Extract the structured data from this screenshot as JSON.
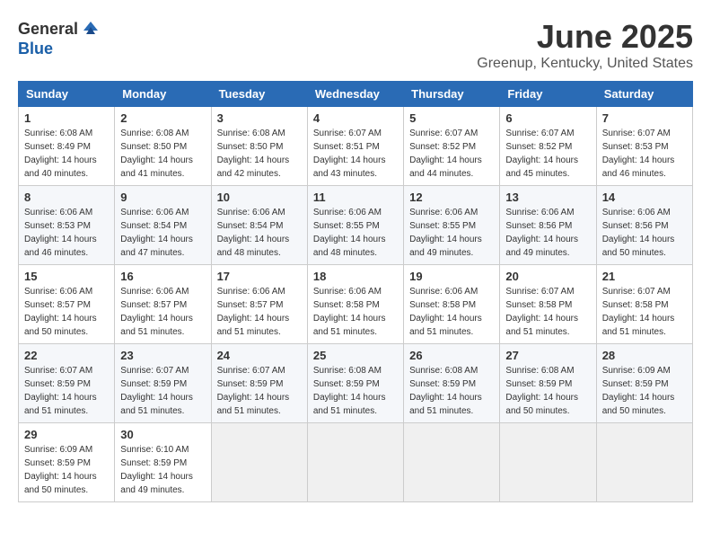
{
  "header": {
    "logo_general": "General",
    "logo_blue": "Blue",
    "month": "June 2025",
    "location": "Greenup, Kentucky, United States"
  },
  "weekdays": [
    "Sunday",
    "Monday",
    "Tuesday",
    "Wednesday",
    "Thursday",
    "Friday",
    "Saturday"
  ],
  "weeks": [
    [
      {
        "day": "1",
        "sunrise": "6:08 AM",
        "sunset": "8:49 PM",
        "daylight": "14 hours and 40 minutes."
      },
      {
        "day": "2",
        "sunrise": "6:08 AM",
        "sunset": "8:50 PM",
        "daylight": "14 hours and 41 minutes."
      },
      {
        "day": "3",
        "sunrise": "6:08 AM",
        "sunset": "8:50 PM",
        "daylight": "14 hours and 42 minutes."
      },
      {
        "day": "4",
        "sunrise": "6:07 AM",
        "sunset": "8:51 PM",
        "daylight": "14 hours and 43 minutes."
      },
      {
        "day": "5",
        "sunrise": "6:07 AM",
        "sunset": "8:52 PM",
        "daylight": "14 hours and 44 minutes."
      },
      {
        "day": "6",
        "sunrise": "6:07 AM",
        "sunset": "8:52 PM",
        "daylight": "14 hours and 45 minutes."
      },
      {
        "day": "7",
        "sunrise": "6:07 AM",
        "sunset": "8:53 PM",
        "daylight": "14 hours and 46 minutes."
      }
    ],
    [
      {
        "day": "8",
        "sunrise": "6:06 AM",
        "sunset": "8:53 PM",
        "daylight": "14 hours and 46 minutes."
      },
      {
        "day": "9",
        "sunrise": "6:06 AM",
        "sunset": "8:54 PM",
        "daylight": "14 hours and 47 minutes."
      },
      {
        "day": "10",
        "sunrise": "6:06 AM",
        "sunset": "8:54 PM",
        "daylight": "14 hours and 48 minutes."
      },
      {
        "day": "11",
        "sunrise": "6:06 AM",
        "sunset": "8:55 PM",
        "daylight": "14 hours and 48 minutes."
      },
      {
        "day": "12",
        "sunrise": "6:06 AM",
        "sunset": "8:55 PM",
        "daylight": "14 hours and 49 minutes."
      },
      {
        "day": "13",
        "sunrise": "6:06 AM",
        "sunset": "8:56 PM",
        "daylight": "14 hours and 49 minutes."
      },
      {
        "day": "14",
        "sunrise": "6:06 AM",
        "sunset": "8:56 PM",
        "daylight": "14 hours and 50 minutes."
      }
    ],
    [
      {
        "day": "15",
        "sunrise": "6:06 AM",
        "sunset": "8:57 PM",
        "daylight": "14 hours and 50 minutes."
      },
      {
        "day": "16",
        "sunrise": "6:06 AM",
        "sunset": "8:57 PM",
        "daylight": "14 hours and 51 minutes."
      },
      {
        "day": "17",
        "sunrise": "6:06 AM",
        "sunset": "8:57 PM",
        "daylight": "14 hours and 51 minutes."
      },
      {
        "day": "18",
        "sunrise": "6:06 AM",
        "sunset": "8:58 PM",
        "daylight": "14 hours and 51 minutes."
      },
      {
        "day": "19",
        "sunrise": "6:06 AM",
        "sunset": "8:58 PM",
        "daylight": "14 hours and 51 minutes."
      },
      {
        "day": "20",
        "sunrise": "6:07 AM",
        "sunset": "8:58 PM",
        "daylight": "14 hours and 51 minutes."
      },
      {
        "day": "21",
        "sunrise": "6:07 AM",
        "sunset": "8:58 PM",
        "daylight": "14 hours and 51 minutes."
      }
    ],
    [
      {
        "day": "22",
        "sunrise": "6:07 AM",
        "sunset": "8:59 PM",
        "daylight": "14 hours and 51 minutes."
      },
      {
        "day": "23",
        "sunrise": "6:07 AM",
        "sunset": "8:59 PM",
        "daylight": "14 hours and 51 minutes."
      },
      {
        "day": "24",
        "sunrise": "6:07 AM",
        "sunset": "8:59 PM",
        "daylight": "14 hours and 51 minutes."
      },
      {
        "day": "25",
        "sunrise": "6:08 AM",
        "sunset": "8:59 PM",
        "daylight": "14 hours and 51 minutes."
      },
      {
        "day": "26",
        "sunrise": "6:08 AM",
        "sunset": "8:59 PM",
        "daylight": "14 hours and 51 minutes."
      },
      {
        "day": "27",
        "sunrise": "6:08 AM",
        "sunset": "8:59 PM",
        "daylight": "14 hours and 50 minutes."
      },
      {
        "day": "28",
        "sunrise": "6:09 AM",
        "sunset": "8:59 PM",
        "daylight": "14 hours and 50 minutes."
      }
    ],
    [
      {
        "day": "29",
        "sunrise": "6:09 AM",
        "sunset": "8:59 PM",
        "daylight": "14 hours and 50 minutes."
      },
      {
        "day": "30",
        "sunrise": "6:10 AM",
        "sunset": "8:59 PM",
        "daylight": "14 hours and 49 minutes."
      },
      null,
      null,
      null,
      null,
      null
    ]
  ],
  "labels": {
    "sunrise": "Sunrise:",
    "sunset": "Sunset:",
    "daylight": "Daylight:"
  }
}
